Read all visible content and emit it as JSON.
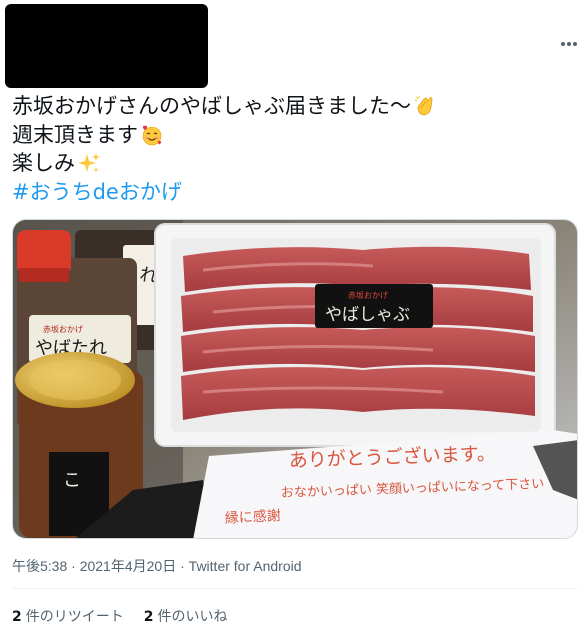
{
  "tweet": {
    "lines": [
      "赤坂おかげさんのやばしゃぶ届きました〜",
      "週末頂きます",
      "楽しみ"
    ],
    "hashtag": "#おうちdeおかげ",
    "emojis": [
      "clapping-hands-emoji",
      "smiling-face-with-hearts-emoji",
      "sparkles-emoji"
    ],
    "more_icon": "more-horizontal-icon"
  },
  "media": {
    "tray_label_small": "赤坂おかげ",
    "tray_label_main": "やばしゃぶ",
    "jar_label_small": "赤坂おかげ",
    "jar_label_main": "やばたれ",
    "card_line1": "ありがとうございます。",
    "card_line2": "おなかいっぱい 笑顔いっぱいになって下さい",
    "card_line3": "縁に感謝"
  },
  "meta": {
    "time": "午後5:38",
    "separator": " · ",
    "date": "2021年4月20日",
    "source": "Twitter for Android"
  },
  "stats": {
    "retweets_count": "2",
    "retweets_label": "件のリツイート",
    "likes_count": "2",
    "likes_label": "件のいいね"
  },
  "colors": {
    "hashtag": "#1d9bf0",
    "secondary_text": "#536471",
    "primary_text": "#0f1419"
  }
}
